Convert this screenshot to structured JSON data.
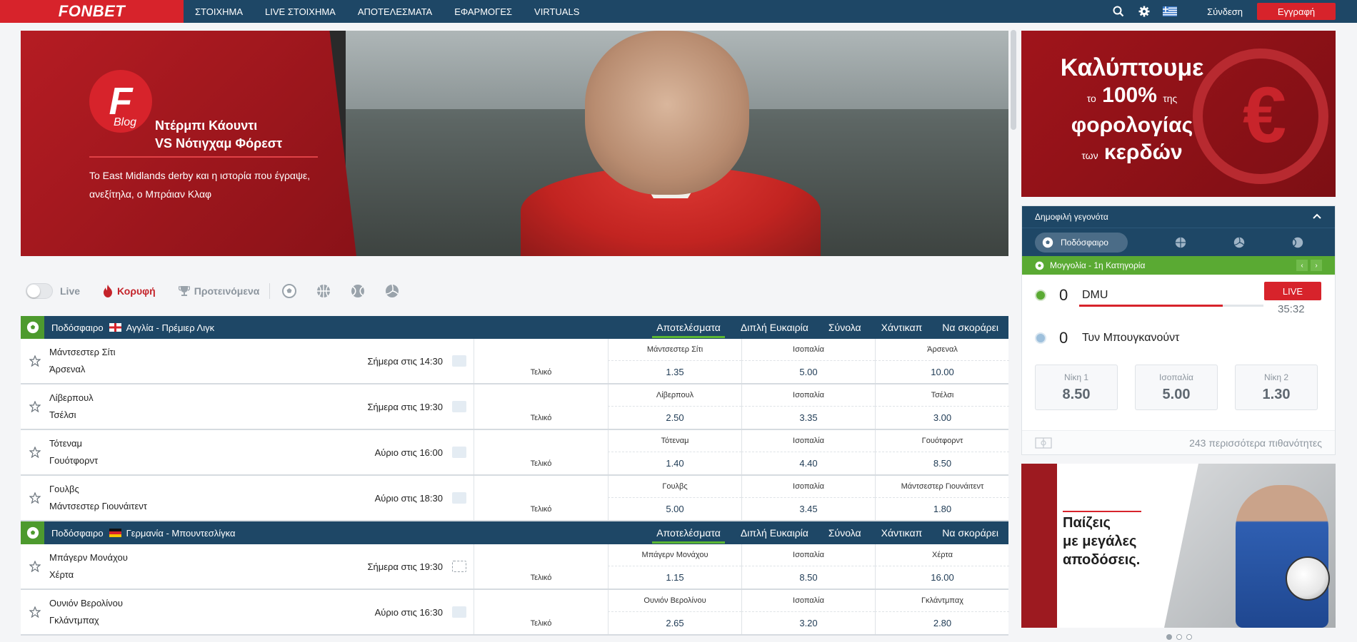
{
  "brand": "FONBET",
  "nav": [
    "ΣΤΟΙΧΗΜΑ",
    "LIVE ΣΤΟΙΧΗΜΑ",
    "ΑΠΟΤΕΛΕΣΜΑΤΑ",
    "ΕΦΑΡΜΟΓΕΣ",
    "VIRTUALS"
  ],
  "header": {
    "login": "Σύνδεση",
    "register": "Εγγραφή"
  },
  "hero": {
    "blog_label": "Blog",
    "title_line1": "Ντέρμπι Κάουντι",
    "title_line2": "VS Νότιγχαμ Φόρεστ",
    "text": "To East Midlands derby και η ιστορία που έγραψε, ανεξίτηλα, ο Μπράιαν Κλαφ"
  },
  "filters": {
    "live": "Live",
    "top": "Κορυφή",
    "recommended": "Προτεινόμενα"
  },
  "tabs": [
    "Αποτελέσματα",
    "Διπλή Ευκαιρία",
    "Σύνολα",
    "Χάντικαπ",
    "Να σκοράρει"
  ],
  "leagues": [
    {
      "sport": "Ποδόσφαιρο",
      "name": "Αγγλία - Πρέμιερ Λιγκ",
      "matches": [
        {
          "home": "Μάντσεστερ Σίτι",
          "away": "Άρσεναλ",
          "time": "Σήμερα στις 14:30",
          "market": "Τελικό",
          "h1": "Μάντσεστερ Σίτι",
          "hx": "Ισοπαλία",
          "h2": "Άρσεναλ",
          "o1": "1.35",
          "ox": "5.00",
          "o2": "10.00"
        },
        {
          "home": "Λίβερπουλ",
          "away": "Τσέλσι",
          "time": "Σήμερα στις 19:30",
          "market": "Τελικό",
          "h1": "Λίβερπουλ",
          "hx": "Ισοπαλία",
          "h2": "Τσέλσι",
          "o1": "2.50",
          "ox": "3.35",
          "o2": "3.00"
        },
        {
          "home": "Τότεναμ",
          "away": "Γουότφορντ",
          "time": "Αύριο στις 16:00",
          "market": "Τελικό",
          "h1": "Τότεναμ",
          "hx": "Ισοπαλία",
          "h2": "Γουότφορντ",
          "o1": "1.40",
          "ox": "4.40",
          "o2": "8.50"
        },
        {
          "home": "Γουλβς",
          "away": "Μάντσεστερ Γιουνάιτεντ",
          "time": "Αύριο στις 18:30",
          "market": "Τελικό",
          "h1": "Γουλβς",
          "hx": "Ισοπαλία",
          "h2": "Μάντσεστερ Γιουνάιτεντ",
          "o1": "5.00",
          "ox": "3.45",
          "o2": "1.80"
        }
      ]
    },
    {
      "sport": "Ποδόσφαιρο",
      "name": "Γερμανία - Μπουντεσλίγκα",
      "matches": [
        {
          "home": "Μπάγερν Μονάχου",
          "away": "Χέρτα",
          "time": "Σήμερα στις 19:30",
          "market": "Τελικό",
          "h1": "Μπάγερν Μονάχου",
          "hx": "Ισοπαλία",
          "h2": "Χέρτα",
          "o1": "1.15",
          "ox": "8.50",
          "o2": "16.00"
        },
        {
          "home": "Ουνιόν Βερολίνου",
          "away": "Γκλάντμπαχ",
          "time": "Αύριο στις 16:30",
          "market": "Τελικό",
          "h1": "Ουνιόν Βερολίνου",
          "hx": "Ισοπαλία",
          "h2": "Γκλάντμπαχ",
          "o1": "2.65",
          "ox": "3.20",
          "o2": "2.80"
        }
      ]
    }
  ],
  "promo": {
    "l1": "Καλύπτουμε",
    "l2a": "το",
    "l2b": "100%",
    "l2c": "της",
    "l3": "φορολογίας",
    "l4a": "των",
    "l4b": "κερδών"
  },
  "popular": {
    "title": "Δημοφιλή γεγονότα",
    "sport_pill": "Ποδόσφαιρο",
    "competition": "Μογγολία - 1η Κατηγορία",
    "home_score": "0",
    "home": "DMU",
    "away_score": "0",
    "away": "Τυν Μπουγκανούντ",
    "live": "LIVE",
    "clock": "35:32",
    "progress": 0.78,
    "odds": [
      {
        "label": "Νίκη 1",
        "value": "8.50"
      },
      {
        "label": "Ισοπαλία",
        "value": "5.00"
      },
      {
        "label": "Νίκη 2",
        "value": "1.30"
      }
    ],
    "more": "243 περισσότερα πιθανότητες"
  },
  "promo2": {
    "l1": "Παίζεις",
    "l2": "με μεγάλες",
    "l3": "αποδόσεις."
  },
  "colors": {
    "navy": "#1e4766",
    "red": "#d7232b",
    "green": "#5aaa33"
  }
}
